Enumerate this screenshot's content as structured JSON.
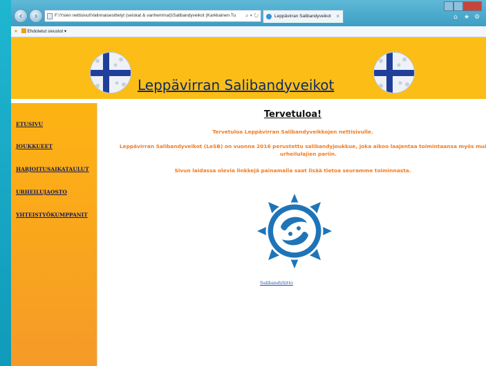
{
  "browser": {
    "address": "F:\\Ysien nettisivut\\Valinnaisesittelyt (seiskat & vanhemmat)\\Salibandyveikot (Karkkainen Tu",
    "tab_title": "Leppävirran Salibandyveikot",
    "favorites_label": "Ehdotetut sivustot ▾"
  },
  "site": {
    "title": "Leppävirran Salibandyveikot"
  },
  "sidebar": {
    "items": [
      {
        "label": "ETUSIVU"
      },
      {
        "label": "JOUKKUEET"
      },
      {
        "label": "HARJOITUSAIKATAULUT"
      },
      {
        "label": "URHEILUJAOSTO"
      },
      {
        "label": "YHTEISTYÖKUMPPANIT"
      }
    ]
  },
  "main": {
    "heading": "Tervetuloa!",
    "p1": "Tervetuloa Leppävirran Salibandyveikkojen nettisivulle.",
    "p2": "Leppävirran Salibandyveikot (LeSB) on vuonna 2016 perustettu salibandyjoukkue, joka aikoo laajentaa toimintaansa myös muiden urheilulajien pariin.",
    "p3": "Sivun laidassa olevia linkkejä painamalla saat lisää tietoa seuramme toiminnasta.",
    "logo_link": "Salibandyliitto"
  },
  "colors": {
    "banner": "#fcbe16",
    "sidebar": "#fba91a",
    "text_orange": "#f07b1f",
    "link_navy": "#131a5a",
    "logo_blue": "#1f74b8"
  }
}
